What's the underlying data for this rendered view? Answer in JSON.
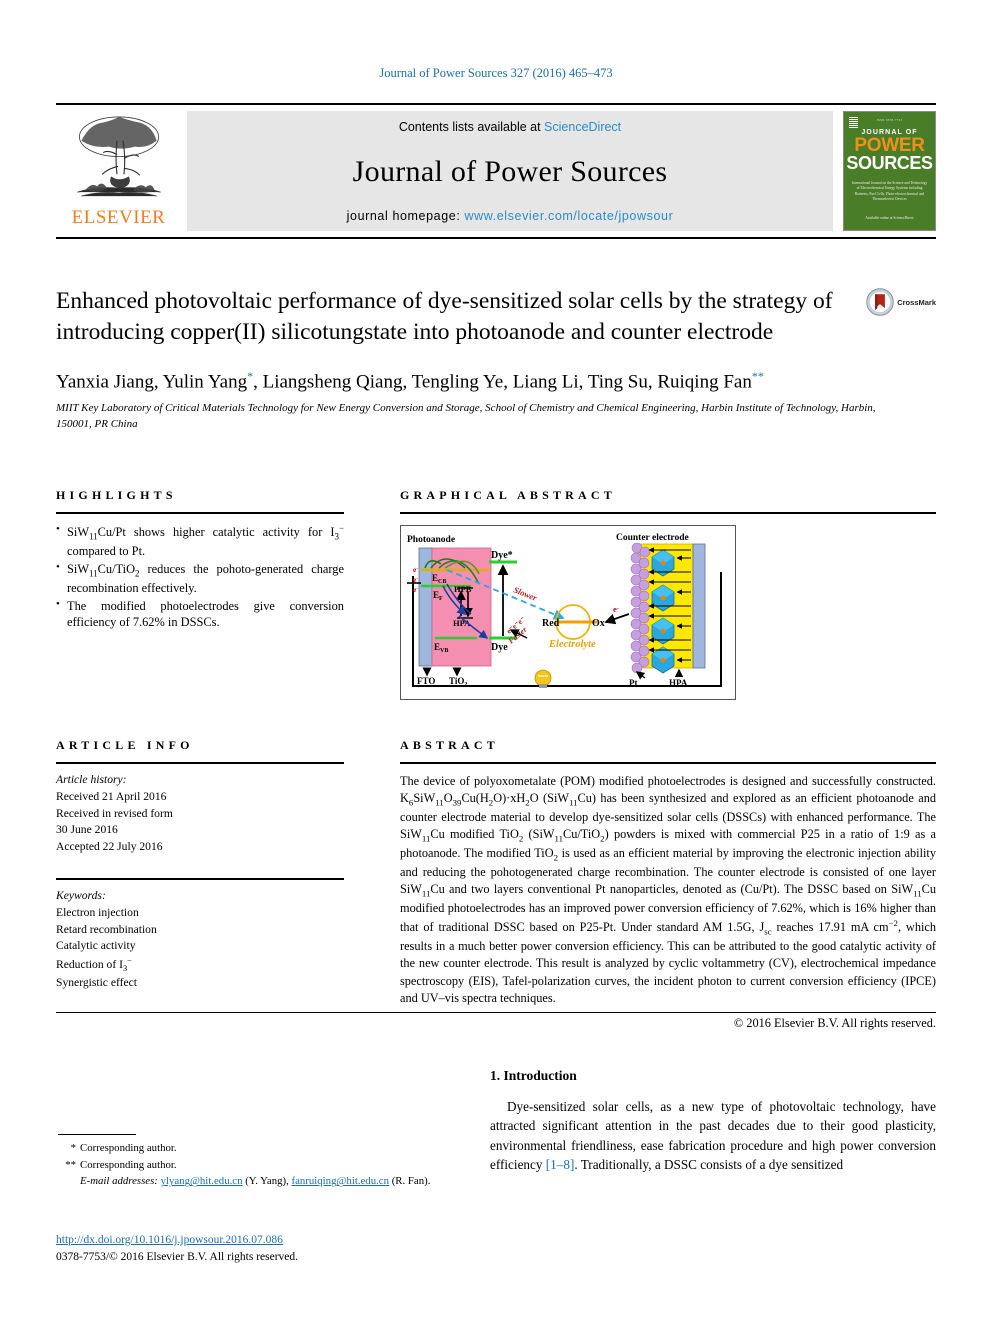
{
  "running_head": "Journal of Power Sources 327 (2016) 465–473",
  "masthead": {
    "contents_prefix": "Contents lists available at ",
    "contents_link": "ScienceDirect",
    "journal_title": "Journal of Power Sources",
    "homepage_prefix": "journal homepage: ",
    "homepage_link": "www.elsevier.com/locate/jpowsour",
    "publisher": "ELSEVIER",
    "cover": {
      "top_line": "ISSN 0378-7753",
      "journal_word": "JOURNAL OF",
      "power": "POWER",
      "sources": "SOURCES",
      "subtitle": "International Journal on the Science and Technology of Electrochemical Energy Systems including Batteries, Fuel Cells, Photo-electrochemical and Thermoelectric Devices",
      "bottom": "Available online at\nScienceDirect"
    }
  },
  "article": {
    "title": "Enhanced photovoltaic performance of dye-sensitized solar cells by the strategy of introducing copper(II) silicotungstate into photoanode and counter electrode",
    "crossmark_label": "CrossMark",
    "authors_plain": "Yanxia Jiang, Yulin Yang",
    "authors": [
      {
        "name": "Yanxia Jiang",
        "mark": ""
      },
      {
        "name": "Yulin Yang",
        "mark": "*"
      },
      {
        "name": "Liangsheng Qiang",
        "mark": ""
      },
      {
        "name": "Tengling Ye",
        "mark": ""
      },
      {
        "name": "Liang Li",
        "mark": ""
      },
      {
        "name": "Ting Su",
        "mark": ""
      },
      {
        "name": "Ruiqing Fan",
        "mark": "**"
      }
    ],
    "affiliation": "MIIT Key Laboratory of Critical Materials Technology for New Energy Conversion and Storage, School of Chemistry and Chemical Engineering, Harbin Institute of Technology, Harbin, 150001, PR China"
  },
  "highlights": {
    "heading": "HIGHLIGHTS",
    "items": [
      "SiW11Cu/Pt shows higher catalytic activity for I3− compared to Pt.",
      "SiW11Cu/TiO2 reduces the pohoto-generated charge recombination effectively.",
      "The modified photoelectrodes give conversion efficiency of 7.62% in DSSCs."
    ]
  },
  "graphical_abstract": {
    "heading": "GRAPHICAL ABSTRACT",
    "figure_labels": {
      "photoanode": "Photoanode",
      "counter_electrode": "Counter electrode",
      "fto": "FTO",
      "tio2": "TiO2",
      "ecb": "ECB",
      "ef": "EF",
      "evb": "EVB",
      "hpb": "HPB",
      "hpa": "HPA",
      "dye_star": "Dye*",
      "dye": "Dye",
      "red": "Red",
      "ox": "Ox",
      "electrolyte": "Electrolyte",
      "slower": "Slower",
      "faster": "Faster",
      "electron": "e-",
      "pt": "Pt",
      "hpa_right": "HPA"
    }
  },
  "article_info": {
    "heading": "ARTICLE INFO",
    "history_label": "Article history:",
    "history": [
      "Received 21 April 2016",
      "Received in revised form",
      "30 June 2016",
      "Accepted 22 July 2016"
    ],
    "keywords_label": "Keywords:",
    "keywords": [
      "Electron injection",
      "Retard recombination",
      "Catalytic activity",
      "Reduction of I3−",
      "Synergistic effect"
    ]
  },
  "abstract": {
    "heading": "ABSTRACT",
    "body": "The device of polyoxometalate (POM) modified photoelectrodes is designed and successfully constructed. K6SiW11O39Cu(H2O)·xH2O (SiW11Cu) has been synthesized and explored as an efficient photoanode and counter electrode material to develop dye-sensitized solar cells (DSSCs) with enhanced performance. The SiW11Cu modified TiO2 (SiW11Cu/TiO2) powders is mixed with commercial P25 in a ratio of 1:9 as a photoanode. The modified TiO2 is used as an efficient material by improving the electronic injection ability and reducing the pohotogenerated charge recombination. The counter electrode is consisted of one layer SiW11Cu and two layers conventional Pt nanoparticles, denoted as (Cu/Pt). The DSSC based on SiW11Cu modified photoelectrodes has an improved power conversion efficiency of 7.62%, which is 16% higher than that of traditional DSSC based on P25-Pt. Under standard AM 1.5G, Jsc reaches 17.91 mA cm−2, which results in a much better power conversion efficiency. This can be attributed to the good catalytic activity of the new counter electrode. This result is analyzed by cyclic voltammetry (CV), electrochemical impedance spectroscopy (EIS), Tafel-polarization curves, the incident photon to current conversion efficiency (IPCE) and UV–vis spectra techniques.",
    "copyright": "© 2016 Elsevier B.V. All rights reserved."
  },
  "introduction": {
    "heading": "1. Introduction",
    "paragraph_part1": "Dye-sensitized solar cells, as a new type of photovoltaic technology, have attracted significant attention in the past decades due to their good plasticity, environmental friendliness, ease fabrication procedure and high power conversion efficiency ",
    "citation": "[1–8]",
    "paragraph_part2": ". Traditionally, a DSSC consists of a dye sensitized"
  },
  "footnotes": {
    "corresponding_1_mark": "*",
    "corresponding_1": "Corresponding author.",
    "corresponding_2_mark": "**",
    "corresponding_2": "Corresponding author.",
    "email_label": "E-mail addresses:",
    "email_1": "ylyang@hit.edu.cn",
    "email_1_owner": "(Y. Yang),",
    "email_2": "fanruiqing@hit.edu.cn",
    "email_2_owner": "(R. Fan)."
  },
  "doi_block": {
    "doi": "http://dx.doi.org/10.1016/j.jpowsour.2016.07.086",
    "issn_line": "0378-7753/© 2016 Elsevier B.V. All rights reserved."
  },
  "colors": {
    "link": "#1a6fa8",
    "sciencedirect": "#2b8cc4",
    "elsevier_orange": "#F47B20",
    "cover_green": "#4a7d28",
    "figure_pink": "#f48fb1",
    "figure_yellow": "#ffe800",
    "figure_purple": "#c79fe0",
    "figure_blue": "#9fb6dd"
  }
}
